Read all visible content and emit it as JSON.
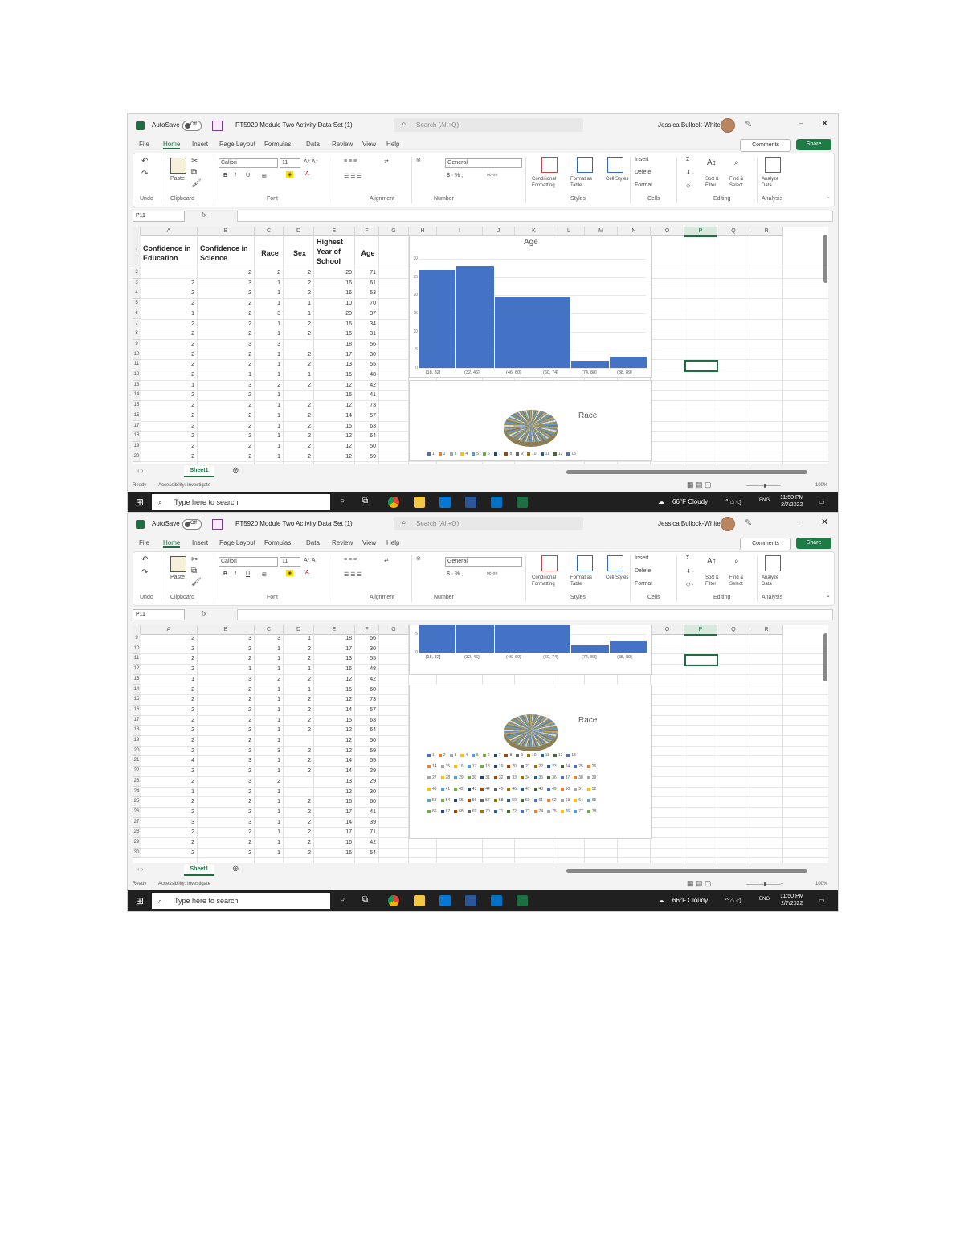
{
  "window": {
    "autosave_label": "AutoSave",
    "autosave_state": "Off",
    "file_title": "PT5920 Module Two Activity Data Set (1)",
    "search_placeholder": "Search (Alt+Q)",
    "user_name": "Jessica Bullock-White"
  },
  "menu": [
    "File",
    "Home",
    "Insert",
    "Page Layout",
    "Formulas",
    "Data",
    "Review",
    "View",
    "Help"
  ],
  "active_menu": "Home",
  "buttons": {
    "comments": "Comments",
    "share": "Share"
  },
  "ribbon": {
    "font_name": "Calibri",
    "font_size": "11",
    "number_format": "General",
    "paste": "Paste",
    "conditional_formatting": "Conditional Formatting",
    "format_as_table": "Format as Table",
    "cell_styles": "Cell Styles",
    "insert": "Insert",
    "delete": "Delete",
    "format": "Format",
    "sort_filter": "Sort & Filter",
    "find_select": "Find & Select",
    "analyze_data": "Analyze Data",
    "groups": [
      "Undo",
      "Clipboard",
      "Font",
      "Alignment",
      "Number",
      "Styles",
      "Cells",
      "Editing",
      "Analysis"
    ]
  },
  "name_box": "P11",
  "fx_label": "fx",
  "columns": [
    "A",
    "B",
    "C",
    "D",
    "E",
    "F",
    "G",
    "H",
    "I",
    "J",
    "K",
    "L",
    "M",
    "N",
    "O",
    "P",
    "Q",
    "R",
    "S"
  ],
  "selected_column": "P",
  "table_headers": {
    "a": "Confidence in Education",
    "b": "Confidence in Science",
    "c": "Race",
    "d": "Sex",
    "e": "Highest Year of School",
    "f": "Age"
  },
  "screen1": {
    "rows": [
      {
        "n": "1"
      },
      {
        "n": "2",
        "a": "",
        "b": "2",
        "c": "2",
        "d": "2",
        "e": "20",
        "f": "71"
      },
      {
        "n": "3",
        "a": "2",
        "b": "3",
        "c": "1",
        "d": "2",
        "e": "16",
        "f": "61"
      },
      {
        "n": "4",
        "a": "2",
        "b": "2",
        "c": "1",
        "d": "2",
        "e": "16",
        "f": "53"
      },
      {
        "n": "5",
        "a": "2",
        "b": "2",
        "c": "1",
        "d": "1",
        "e": "10",
        "f": "70"
      },
      {
        "n": "6",
        "a": "1",
        "b": "2",
        "c": "3",
        "d": "1",
        "e": "20",
        "f": "37"
      },
      {
        "n": "7",
        "a": "2",
        "b": "2",
        "c": "1",
        "d": "2",
        "e": "16",
        "f": "34"
      },
      {
        "n": "8",
        "a": "2",
        "b": "2",
        "c": "1",
        "d": "2",
        "e": "16",
        "f": "31"
      },
      {
        "n": "9",
        "a": "2",
        "b": "3",
        "c": "3",
        "d": "",
        "e": "18",
        "f": "56"
      },
      {
        "n": "10",
        "a": "2",
        "b": "2",
        "c": "1",
        "d": "2",
        "e": "17",
        "f": "30"
      },
      {
        "n": "11",
        "a": "2",
        "b": "2",
        "c": "1",
        "d": "2",
        "e": "13",
        "f": "55"
      },
      {
        "n": "12",
        "a": "2",
        "b": "1",
        "c": "1",
        "d": "1",
        "e": "16",
        "f": "48"
      },
      {
        "n": "13",
        "a": "1",
        "b": "3",
        "c": "2",
        "d": "2",
        "e": "12",
        "f": "42"
      },
      {
        "n": "14",
        "a": "2",
        "b": "2",
        "c": "1",
        "d": "",
        "e": "16",
        "f": "41"
      },
      {
        "n": "15",
        "a": "2",
        "b": "2",
        "c": "1",
        "d": "2",
        "e": "12",
        "f": "73"
      },
      {
        "n": "16",
        "a": "2",
        "b": "2",
        "c": "1",
        "d": "2",
        "e": "14",
        "f": "57"
      },
      {
        "n": "17",
        "a": "2",
        "b": "2",
        "c": "1",
        "d": "2",
        "e": "15",
        "f": "63"
      },
      {
        "n": "18",
        "a": "2",
        "b": "2",
        "c": "1",
        "d": "2",
        "e": "12",
        "f": "64"
      },
      {
        "n": "19",
        "a": "2",
        "b": "2",
        "c": "1",
        "d": "2",
        "e": "12",
        "f": "50"
      },
      {
        "n": "20",
        "a": "2",
        "b": "2",
        "c": "1",
        "d": "2",
        "e": "12",
        "f": "59"
      }
    ]
  },
  "screen2": {
    "rows": [
      {
        "n": "9",
        "a": "2",
        "b": "3",
        "c": "3",
        "d": "1",
        "e": "18",
        "f": "56"
      },
      {
        "n": "10",
        "a": "2",
        "b": "2",
        "c": "1",
        "d": "2",
        "e": "17",
        "f": "30"
      },
      {
        "n": "11",
        "a": "2",
        "b": "2",
        "c": "1",
        "d": "2",
        "e": "13",
        "f": "55"
      },
      {
        "n": "12",
        "a": "2",
        "b": "1",
        "c": "1",
        "d": "1",
        "e": "16",
        "f": "48"
      },
      {
        "n": "13",
        "a": "1",
        "b": "3",
        "c": "2",
        "d": "2",
        "e": "12",
        "f": "42"
      },
      {
        "n": "14",
        "a": "2",
        "b": "2",
        "c": "1",
        "d": "1",
        "e": "16",
        "f": "60"
      },
      {
        "n": "15",
        "a": "2",
        "b": "2",
        "c": "1",
        "d": "2",
        "e": "12",
        "f": "73"
      },
      {
        "n": "16",
        "a": "2",
        "b": "2",
        "c": "1",
        "d": "2",
        "e": "14",
        "f": "57"
      },
      {
        "n": "17",
        "a": "2",
        "b": "2",
        "c": "1",
        "d": "2",
        "e": "15",
        "f": "63"
      },
      {
        "n": "18",
        "a": "2",
        "b": "2",
        "c": "1",
        "d": "2",
        "e": "12",
        "f": "64"
      },
      {
        "n": "19",
        "a": "2",
        "b": "2",
        "c": "1",
        "d": "",
        "e": "12",
        "f": "50"
      },
      {
        "n": "20",
        "a": "2",
        "b": "2",
        "c": "3",
        "d": "2",
        "e": "12",
        "f": "59"
      },
      {
        "n": "21",
        "a": "4",
        "b": "3",
        "c": "1",
        "d": "2",
        "e": "14",
        "f": "55"
      },
      {
        "n": "22",
        "a": "2",
        "b": "2",
        "c": "1",
        "d": "2",
        "e": "14",
        "f": "29"
      },
      {
        "n": "23",
        "a": "2",
        "b": "3",
        "c": "2",
        "d": "",
        "e": "13",
        "f": "29"
      },
      {
        "n": "24",
        "a": "1",
        "b": "2",
        "c": "1",
        "d": "",
        "e": "12",
        "f": "30"
      },
      {
        "n": "25",
        "a": "2",
        "b": "2",
        "c": "1",
        "d": "2",
        "e": "16",
        "f": "60"
      },
      {
        "n": "26",
        "a": "2",
        "b": "2",
        "c": "1",
        "d": "2",
        "e": "17",
        "f": "41"
      },
      {
        "n": "27",
        "a": "3",
        "b": "3",
        "c": "1",
        "d": "2",
        "e": "14",
        "f": "39"
      },
      {
        "n": "28",
        "a": "2",
        "b": "2",
        "c": "1",
        "d": "2",
        "e": "17",
        "f": "71"
      },
      {
        "n": "29",
        "a": "2",
        "b": "2",
        "c": "1",
        "d": "2",
        "e": "16",
        "f": "42"
      },
      {
        "n": "30",
        "a": "2",
        "b": "2",
        "c": "1",
        "d": "2",
        "e": "16",
        "f": "54"
      }
    ]
  },
  "chart_data": [
    {
      "type": "bar",
      "title": "Age",
      "categories": [
        "[18, 32]",
        "(32, 46]",
        "(46, 60]",
        "(60, 74]",
        "(74, 88]",
        "(88, 89]"
      ],
      "values": [
        27,
        28,
        19.5,
        2,
        3,
        3
      ],
      "ylim": [
        0,
        30
      ],
      "yticks": [
        "0",
        "5",
        "10",
        "15",
        "20",
        "25",
        "30"
      ],
      "grid": true
    },
    {
      "type": "pie",
      "title": "Race",
      "legend_position": "bottom",
      "legend_entries": [
        "1",
        "2",
        "3",
        "4",
        "5",
        "6",
        "7",
        "8",
        "9",
        "10",
        "11",
        "12",
        "13",
        "14",
        "15",
        "16",
        "17",
        "18",
        "19",
        "20",
        "21",
        "22",
        "23",
        "24",
        "25",
        "26",
        "27",
        "28",
        "29",
        "30",
        "31",
        "32",
        "33",
        "34",
        "35",
        "36",
        "37",
        "38",
        "39",
        "40",
        "41",
        "42",
        "43",
        "44",
        "45",
        "46",
        "47",
        "48",
        "49",
        "50",
        "51",
        "52",
        "53",
        "54",
        "55",
        "56",
        "57",
        "58",
        "59",
        "60",
        "61",
        "62",
        "63",
        "64",
        "65",
        "66",
        "67",
        "68",
        "69",
        "70",
        "71",
        "72",
        "73",
        "74",
        "75",
        "76",
        "77",
        "78"
      ]
    }
  ],
  "sheet_tab": "Sheet1",
  "status": {
    "ready": "Ready",
    "accessibility": "Accessibility: Investigate",
    "zoom": "100%"
  },
  "taskbar": {
    "search_placeholder": "Type here to search",
    "weather": "66°F Cloudy",
    "language": "ENG",
    "time": "11:50 PM",
    "date": "2/7/2022"
  },
  "colors": {
    "excel_green": "#1d6f42",
    "bar_blue": "#4472c4",
    "taskbar": "#202020"
  }
}
